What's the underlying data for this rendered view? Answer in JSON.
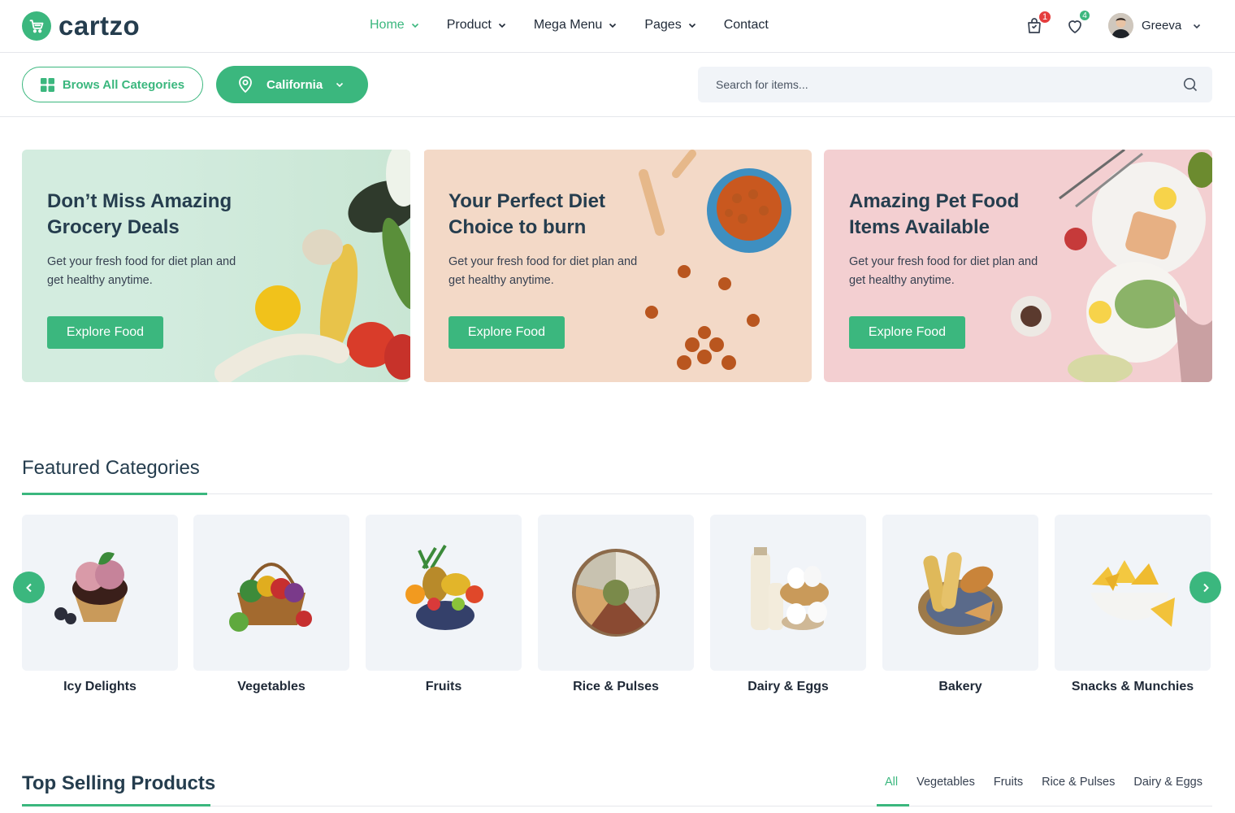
{
  "header": {
    "logo_text": "cartzo",
    "nav": [
      {
        "label": "Home",
        "active": true,
        "dropdown": true
      },
      {
        "label": "Product",
        "active": false,
        "dropdown": true
      },
      {
        "label": "Mega Menu",
        "active": false,
        "dropdown": true
      },
      {
        "label": "Pages",
        "active": false,
        "dropdown": true
      },
      {
        "label": "Contact",
        "active": false,
        "dropdown": false
      }
    ],
    "cart_count": "1",
    "wishlist_count": "4",
    "user_name": "Greeva"
  },
  "subbar": {
    "browse_label": "Brows All Categories",
    "location_label": "California",
    "search_placeholder": "Search for items..."
  },
  "banners": [
    {
      "title": "Don’t Miss Amazing Grocery Deals",
      "desc": "Get your fresh food for diet plan and get healthy anytime.",
      "cta": "Explore Food",
      "bg": "#d3ecdf"
    },
    {
      "title": "Your Perfect Diet Choice to burn",
      "desc": "Get your fresh food for diet plan and get healthy anytime.",
      "cta": "Explore Food",
      "bg": "#f3d9c7"
    },
    {
      "title": "Amazing Pet Food Items Available",
      "desc": "Get your fresh food for diet plan and get healthy anytime.",
      "cta": "Explore Food",
      "bg": "#f3cfd1"
    }
  ],
  "featured": {
    "title": "Featured Categories",
    "categories": [
      {
        "label": "Icy Delights",
        "icon": "ice-cream-icon"
      },
      {
        "label": "Vegetables",
        "icon": "vegetable-basket-icon"
      },
      {
        "label": "Fruits",
        "icon": "fruit-basket-icon"
      },
      {
        "label": "Rice & Pulses",
        "icon": "grains-plate-icon"
      },
      {
        "label": "Dairy & Eggs",
        "icon": "dairy-eggs-icon"
      },
      {
        "label": "Bakery",
        "icon": "bread-basket-icon"
      },
      {
        "label": "Snacks & Munchies",
        "icon": "chips-bowl-icon"
      }
    ]
  },
  "top_selling": {
    "title": "Top Selling Products",
    "tabs": [
      "All",
      "Vegetables",
      "Fruits",
      "Rice & Pulses",
      "Dairy & Eggs"
    ],
    "active_tab": "All"
  },
  "colors": {
    "accent": "#3bb77e",
    "heading": "#253d4e",
    "badge_red": "#e53e3e"
  }
}
